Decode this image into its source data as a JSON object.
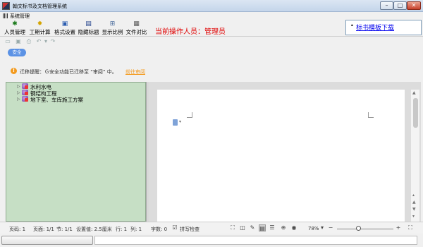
{
  "window": {
    "title": "翰文标书及文档管理系统",
    "controls": {
      "minimize": "–",
      "maximize": "□",
      "close": "✕"
    }
  },
  "menubar": {
    "items": [
      {
        "label": "系统管理"
      }
    ]
  },
  "toolbar": {
    "buttons": [
      {
        "label": "人员管理",
        "icon": "person-icon"
      },
      {
        "label": "工期计算",
        "icon": "calculator-icon"
      },
      {
        "label": "格式设置",
        "icon": "format-icon"
      },
      {
        "label": "隐藏标题",
        "icon": "hide-title-icon"
      },
      {
        "label": "显示比例",
        "icon": "zoom-icon"
      },
      {
        "label": "文件对比",
        "icon": "compare-icon"
      }
    ],
    "operator_text": "当前操作人员：管理员"
  },
  "link_panel": {
    "link": "标书模板下载"
  },
  "security_tag": "安全",
  "notice": {
    "text": "迁移提醒：Ｇ安全功能已迁移至 “审阅” 中。",
    "action": "前往审阅"
  },
  "tree": {
    "items": [
      {
        "label": "水利水电"
      },
      {
        "label": "钢结构工程"
      },
      {
        "label": "地下室、车库施工方案"
      }
    ]
  },
  "statusbar": {
    "page_no": "页码: 1",
    "page_of": "页面: 1/1",
    "section": "节: 1/1",
    "setting": "设置值: 2.5厘米",
    "row": "行: 1",
    "col": "列: 1",
    "chars": "字数: 0",
    "spellcheck": "拼写检查",
    "zoom": "78%",
    "zoom_minus": "−",
    "zoom_plus": "+"
  },
  "colors": {
    "accent_blue": "#5b92e5",
    "operator_red": "#e00000",
    "tree_bg": "#c6dfc5",
    "notice_orange": "#f39a1e"
  }
}
